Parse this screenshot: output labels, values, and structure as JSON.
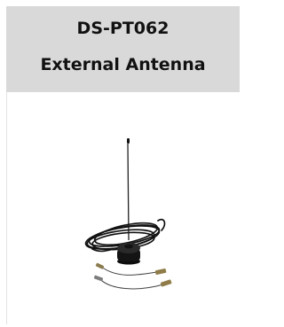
{
  "product": {
    "model": "DS-PT062",
    "name": "External Antenna"
  },
  "colors": {
    "header_bg": "#d9d9d9",
    "text": "#111111",
    "antenna": "#111111"
  }
}
